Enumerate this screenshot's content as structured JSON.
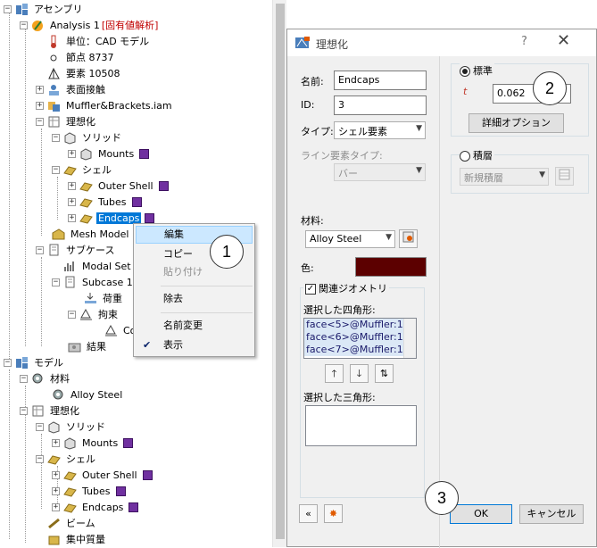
{
  "tree": {
    "top": [
      {
        "label": "アセンブリ",
        "icon": "assembly-icon"
      },
      {
        "label": "Analysis 1",
        "tag": "[固有値解析]",
        "icon": "analysis-icon"
      },
      {
        "label": "単位：CAD モデル",
        "icon": "thermometer-icon"
      },
      {
        "label": "節点 8737",
        "icon": "node-icon"
      },
      {
        "label": "要素 10508",
        "icon": "element-icon"
      },
      {
        "label": "表面接触",
        "icon": "contact-icon"
      },
      {
        "label": "Muffler&Brackets.iam",
        "icon": "assembly-file-icon"
      },
      {
        "label": "理想化",
        "icon": "idealization-icon"
      },
      {
        "label": "ソリッド",
        "icon": "solid-icon"
      },
      {
        "label": "Mounts",
        "icon": "part-icon"
      },
      {
        "label": "シェル",
        "icon": "shell-icon"
      },
      {
        "label": "Outer Shell",
        "icon": "shell-part-icon"
      },
      {
        "label": "Tubes",
        "icon": "shell-part-icon"
      },
      {
        "label": "Endcaps",
        "icon": "shell-part-icon"
      },
      {
        "label": "Mesh Model",
        "icon": "mesh-icon"
      },
      {
        "label": "サブケース",
        "icon": "subcase-icon"
      },
      {
        "label": "Modal Set",
        "icon": "modal-icon"
      },
      {
        "label": "Subcase 1",
        "icon": "subcase-icon"
      },
      {
        "label": "荷重",
        "icon": "load-icon"
      },
      {
        "label": "拘束",
        "icon": "constraint-icon"
      },
      {
        "label": "Co",
        "icon": "constraint-item-icon"
      },
      {
        "label": "結果",
        "icon": "results-icon"
      }
    ],
    "bottom": [
      {
        "label": "モデル",
        "icon": "model-icon"
      },
      {
        "label": "材料",
        "icon": "material-icon"
      },
      {
        "label": "Alloy Steel",
        "icon": "material-item-icon"
      },
      {
        "label": "理想化",
        "icon": "idealization-icon"
      },
      {
        "label": "ソリッド",
        "icon": "solid-icon"
      },
      {
        "label": "Mounts",
        "icon": "part-icon"
      },
      {
        "label": "シェル",
        "icon": "shell-icon"
      },
      {
        "label": "Outer Shell",
        "icon": "shell-part-icon"
      },
      {
        "label": "Tubes",
        "icon": "shell-part-icon"
      },
      {
        "label": "Endcaps",
        "icon": "shell-part-icon"
      },
      {
        "label": "ビーム",
        "icon": "beam-icon"
      },
      {
        "label": "集中質量",
        "icon": "mass-icon"
      }
    ],
    "swatch_color": "#7030a0",
    "selection_color": "#0078d7"
  },
  "context_menu": {
    "items": [
      {
        "label": "編集",
        "highlighted": true
      },
      {
        "label": "コピー"
      },
      {
        "label": "貼り付け",
        "disabled": true
      },
      {
        "label": "除去"
      },
      {
        "label": "名前変更"
      },
      {
        "label": "表示",
        "checked": true
      }
    ]
  },
  "dialog": {
    "title": "理想化",
    "help": "?",
    "close": "✕",
    "name_label": "名前:",
    "name_value": "Endcaps",
    "id_label": "ID:",
    "id_value": "3",
    "type_label": "タイプ:",
    "type_value": "シェル要素",
    "line_type_label": "ライン要素タイプ:",
    "line_type_value": "バー",
    "material_label": "材料:",
    "material_value": "Alloy Steel",
    "color_label": "色:",
    "color_value": "#5c0000",
    "assoc_geom_label": "関連ジオメトリ",
    "quads_label": "選択した四角形:",
    "quads": [
      "face<5>@Muffler:1",
      "face<6>@Muffler:1",
      "face<7>@Muffler:1"
    ],
    "tris_label": "選択した三角形:",
    "standard_label": "標準",
    "thickness_label": "t",
    "thickness_value": "0.062",
    "details_button": "詳細オプション",
    "laminate_label": "積層",
    "laminate_value": "新規積層",
    "ok": "OK",
    "cancel": "キャンセル"
  },
  "callouts": [
    "1",
    "2",
    "3"
  ]
}
